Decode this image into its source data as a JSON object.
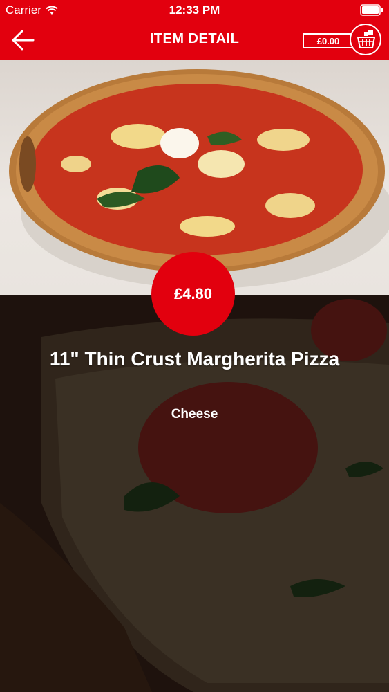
{
  "status_bar": {
    "carrier": "Carrier",
    "time": "12:33 PM",
    "wifi_icon": "wifi-icon",
    "battery_icon": "battery-icon"
  },
  "header": {
    "title": "ITEM DETAIL",
    "back_icon": "arrow-left-icon",
    "cart_total": "£0.00",
    "cart_icon": "basket-icon"
  },
  "item": {
    "price": "£4.80",
    "name": "11\" Thin Crust Margherita Pizza",
    "description": "Cheese",
    "image": "margherita-pizza-photo"
  },
  "colors": {
    "brand_red": "#e2000e",
    "text": "#ffffff"
  }
}
